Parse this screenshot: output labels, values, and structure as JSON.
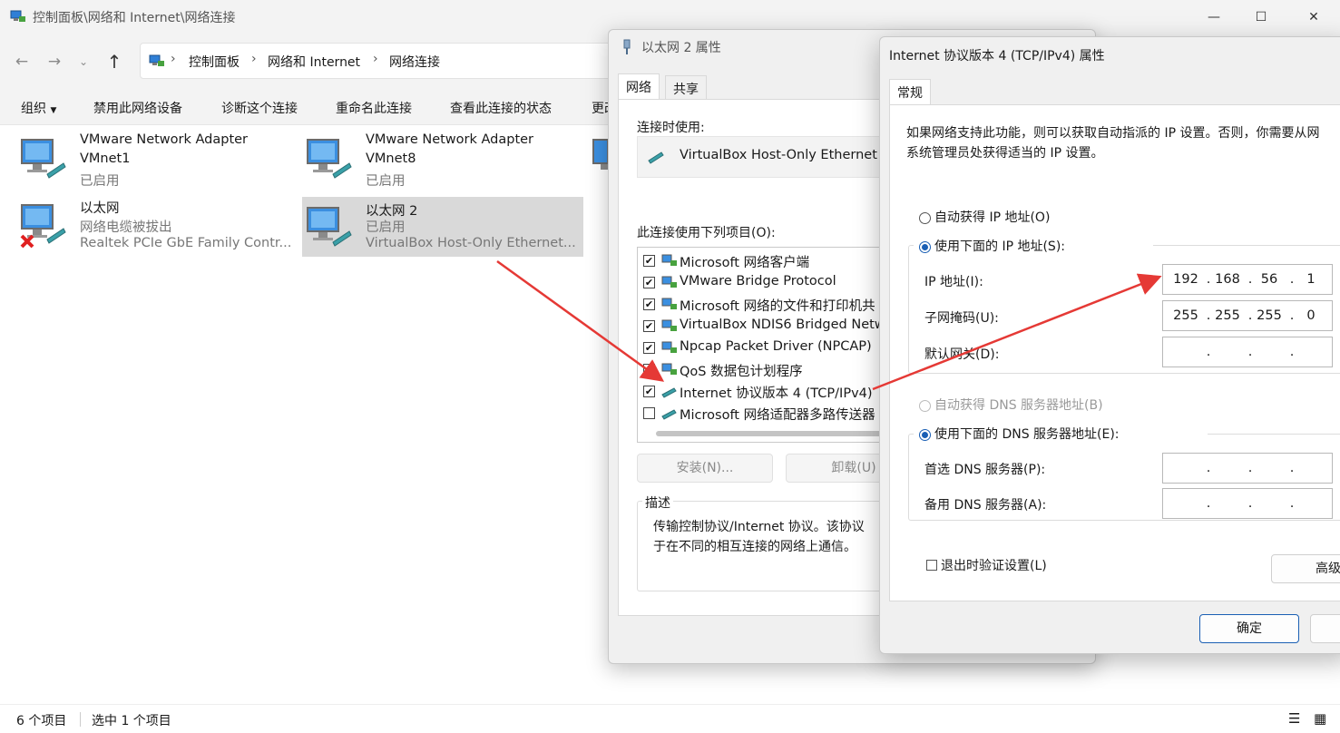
{
  "explorer": {
    "title": "控制面板\\网络和 Internet\\网络连接",
    "breadcrumb": [
      "控制面板",
      "网络和 Internet",
      "网络连接"
    ],
    "commands": [
      "组织",
      "禁用此网络设备",
      "诊断这个连接",
      "重命名此连接",
      "查看此连接的状态",
      "更改"
    ],
    "items": [
      {
        "name": "VMware Network Adapter",
        "line2": "VMnet1",
        "line3": "已启用",
        "status": "ok"
      },
      {
        "name": "VMware Network Adapter",
        "line2": "VMnet8",
        "line3": "已启用",
        "status": "ok"
      },
      {
        "name": "以太网",
        "line2": "网络电缆被拔出",
        "line3": "Realtek PCIe GbE Family Contr...",
        "status": "error"
      },
      {
        "name": "以太网 2",
        "line2": "已启用",
        "line3": "VirtualBox Host-Only Ethernet...",
        "status": "selected"
      }
    ],
    "status": {
      "count": "6 个项目",
      "selected": "选中 1 个项目"
    }
  },
  "dlg_ethernet": {
    "title": "以太网 2 属性",
    "tabs": [
      "网络",
      "共享"
    ],
    "connect_using_label": "连接时使用:",
    "adapter": "VirtualBox Host-Only Ethernet",
    "items_label": "此连接使用下列项目(O):",
    "items": [
      {
        "label": "Microsoft 网络客户端",
        "checked": "✔"
      },
      {
        "label": "VMware Bridge Protocol",
        "checked": "✔"
      },
      {
        "label": "Microsoft 网络的文件和打印机共",
        "checked": "✔"
      },
      {
        "label": "VirtualBox NDIS6 Bridged Netw",
        "checked": "✔"
      },
      {
        "label": "Npcap Packet Driver (NPCAP)",
        "checked": "✔"
      },
      {
        "label": "QoS 数据包计划程序",
        "checked": "✔"
      },
      {
        "label": "Internet 协议版本 4 (TCP/IPv4)",
        "checked": "✔"
      },
      {
        "label": "Microsoft 网络适配器多路传送器",
        "checked": ""
      }
    ],
    "install_button": "安装(N)...",
    "uninstall_button": "卸载(U)",
    "desc_title": "描述",
    "desc_line1": "传输控制协议/Internet 协议。该协议",
    "desc_line2": "于在不同的相互连接的网络上通信。"
  },
  "dlg_ipv4": {
    "title": "Internet 协议版本 4 (TCP/IPv4) 属性",
    "tab": "常规",
    "info_line1": "如果网络支持此功能，则可以获取自动指派的 IP 设置。否则，你需要从网",
    "info_line2": "系统管理员处获得适当的 IP 设置。",
    "auto_ip": "自动获得 IP 地址(O)",
    "manual_ip": "使用下面的 IP 地址(S):",
    "ip_label": "IP 地址(I):",
    "ip": [
      "192",
      "168",
      "56",
      "1"
    ],
    "mask_label": "子网掩码(U):",
    "mask": [
      "255",
      "255",
      "255",
      "0"
    ],
    "gateway_label": "默认网关(D):",
    "gateway": [
      "",
      "",
      "",
      ""
    ],
    "auto_dns": "自动获得 DNS 服务器地址(B)",
    "manual_dns": "使用下面的 DNS 服务器地址(E):",
    "dns1_label": "首选 DNS 服务器(P):",
    "dns1": [
      "",
      "",
      "",
      ""
    ],
    "dns2_label": "备用 DNS 服务器(A):",
    "dns2": [
      "",
      "",
      "",
      ""
    ],
    "validate": "退出时验证设置(L)",
    "advanced_button": "高级(V)",
    "ok_button": "确定",
    "accent": "#1a5fb4"
  },
  "annotation_color": "#e53935"
}
